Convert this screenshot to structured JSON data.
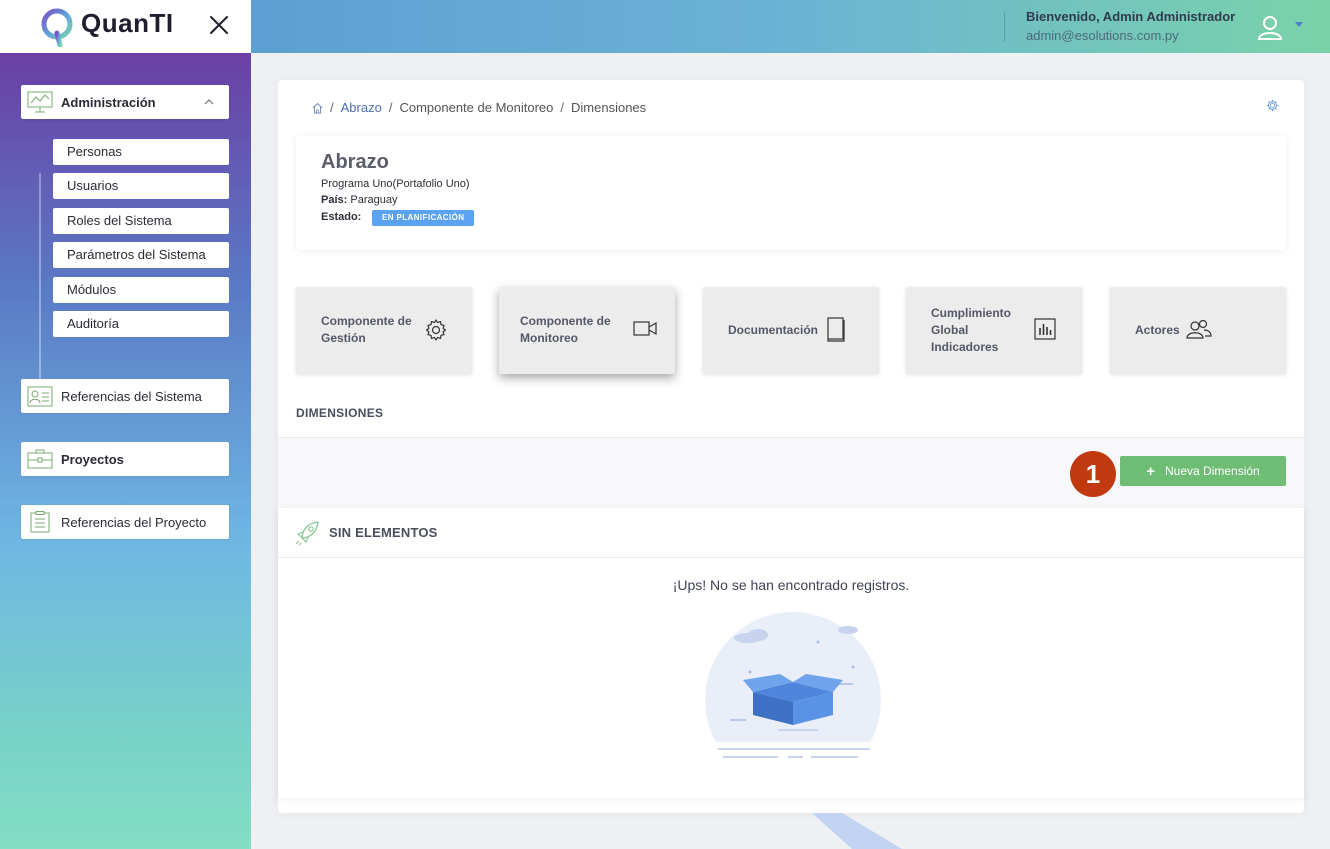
{
  "app": {
    "logo_text": "QuanTI"
  },
  "header": {
    "welcome": "Bienvenido, Admin Administrador",
    "email": "admin@esolutions.com.py"
  },
  "sidebar": {
    "admin_label": "Administración",
    "admin_items": [
      "Personas",
      "Usuarios",
      "Roles del Sistema",
      "Parámetros del Sistema",
      "Módulos",
      "Auditoría"
    ],
    "references_label": "Referencias del Sistema",
    "projects_label": "Proyectos",
    "project_references_label": "Referencias del Proyecto"
  },
  "breadcrumb": {
    "sep": "/",
    "items": [
      "Abrazo",
      "Componente de Monitoreo",
      "Dimensiones"
    ]
  },
  "project": {
    "title": "Abrazo",
    "program": "Programa Uno(Portafolio Uno)",
    "country_label": "País:",
    "country": "Paraguay",
    "state_label": "Estado:",
    "state": "EN PLANIFICACIÓN",
    "state_color": "#5ba2f0"
  },
  "tiles": [
    {
      "lines": [
        "Componente de",
        "Gestión"
      ],
      "icon": "gear-icon"
    },
    {
      "lines": [
        "Componente de",
        "Monitoreo"
      ],
      "icon": "video-icon",
      "active": true
    },
    {
      "lines": [
        "Documentación"
      ],
      "icon": "book-icon"
    },
    {
      "lines": [
        "Cumplimiento",
        "Global",
        "Indicadores"
      ],
      "icon": "bar-chart-icon"
    },
    {
      "lines": [
        "Actores"
      ],
      "icon": "users-icon"
    }
  ],
  "section": {
    "title": "DIMENSIONES",
    "step_number": "1",
    "new_button": "Nueva Dimensión",
    "new_button_icon": "+",
    "button_color": "#6fbc75"
  },
  "empty": {
    "title": "SIN ELEMENTOS",
    "message": "¡Ups! No se han encontrado registros."
  }
}
